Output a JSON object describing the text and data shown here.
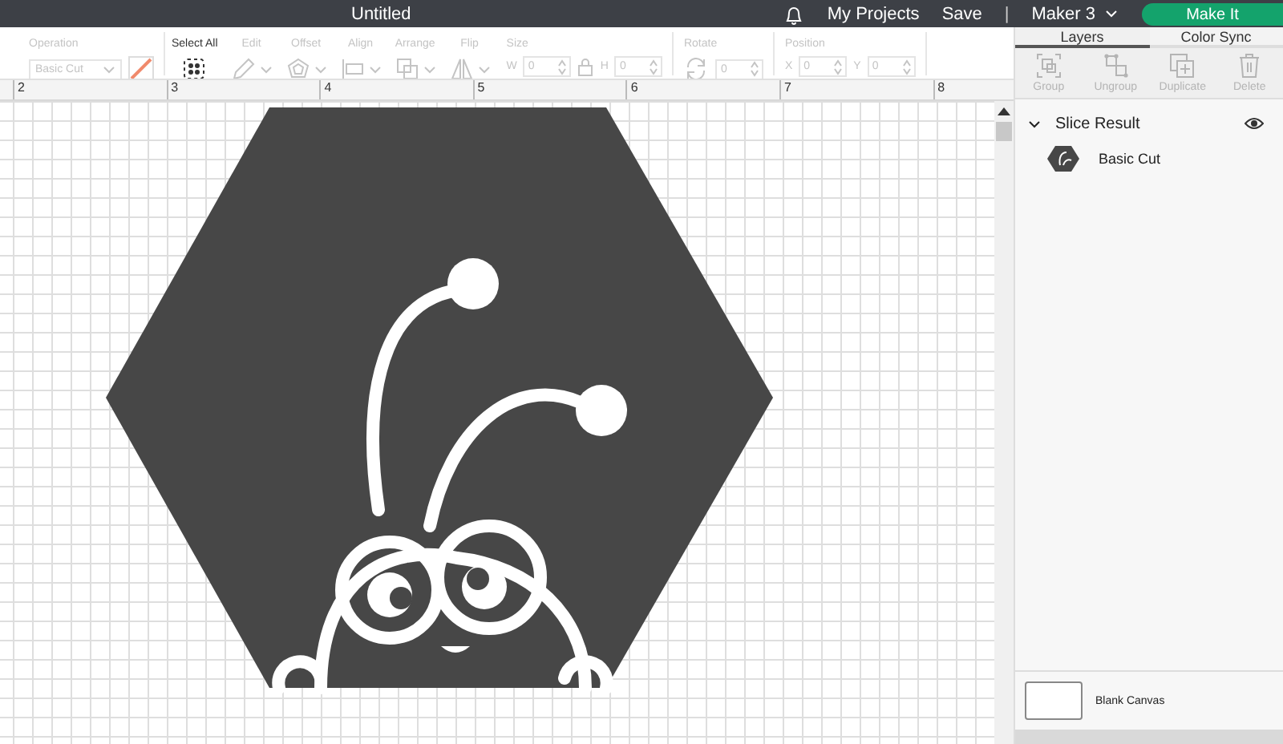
{
  "header": {
    "title": "Untitled",
    "links": [
      "My Projects",
      "Save"
    ],
    "separator": "|",
    "machine": "Maker 3",
    "make_button": "Make It"
  },
  "toolbar": [
    {
      "kind": "operation",
      "label": "Operation",
      "value": "Basic Cut",
      "disabled": true
    },
    {
      "kind": "select",
      "label": "Select All",
      "disabled": false
    },
    {
      "kind": "pencil",
      "label": "Edit",
      "disabled": true
    },
    {
      "kind": "offset",
      "label": "Offset",
      "disabled": true
    },
    {
      "kind": "align",
      "label": "Align",
      "disabled": true
    },
    {
      "kind": "arrange",
      "label": "Arrange",
      "disabled": true
    },
    {
      "kind": "flip",
      "label": "Flip",
      "disabled": true
    },
    {
      "kind": "size",
      "label": "Size",
      "fields": [
        {
          "name": "W",
          "value": "0"
        },
        {
          "name": "H",
          "value": "0"
        }
      ],
      "disabled": true
    },
    {
      "kind": "rotate",
      "label": "Rotate",
      "fields": [
        {
          "value": "0"
        }
      ],
      "disabled": true
    },
    {
      "kind": "position",
      "label": "Position",
      "fields": [
        {
          "name": "X",
          "value": "0"
        },
        {
          "name": "Y",
          "value": "0"
        }
      ],
      "disabled": true
    }
  ],
  "ruler": [
    "2",
    "3",
    "4",
    "5",
    "6",
    "7",
    "8"
  ],
  "panel": {
    "tabs": [
      {
        "label": "Layers",
        "selected": true
      },
      {
        "label": "Color Sync",
        "selected": false
      }
    ],
    "actions": [
      {
        "kind": "group",
        "label": "Group",
        "disabled": true
      },
      {
        "kind": "ungroup",
        "label": "Ungroup",
        "disabled": true
      },
      {
        "kind": "duplicate",
        "label": "Duplicate",
        "disabled": true
      },
      {
        "kind": "delete",
        "label": "Delete",
        "disabled": true
      }
    ],
    "layers": [
      {
        "name": "Slice Result",
        "expanded": true,
        "visible": true,
        "children": [
          {
            "name": "Basic Cut"
          }
        ]
      }
    ],
    "canvas_layer": "Blank Canvas"
  }
}
